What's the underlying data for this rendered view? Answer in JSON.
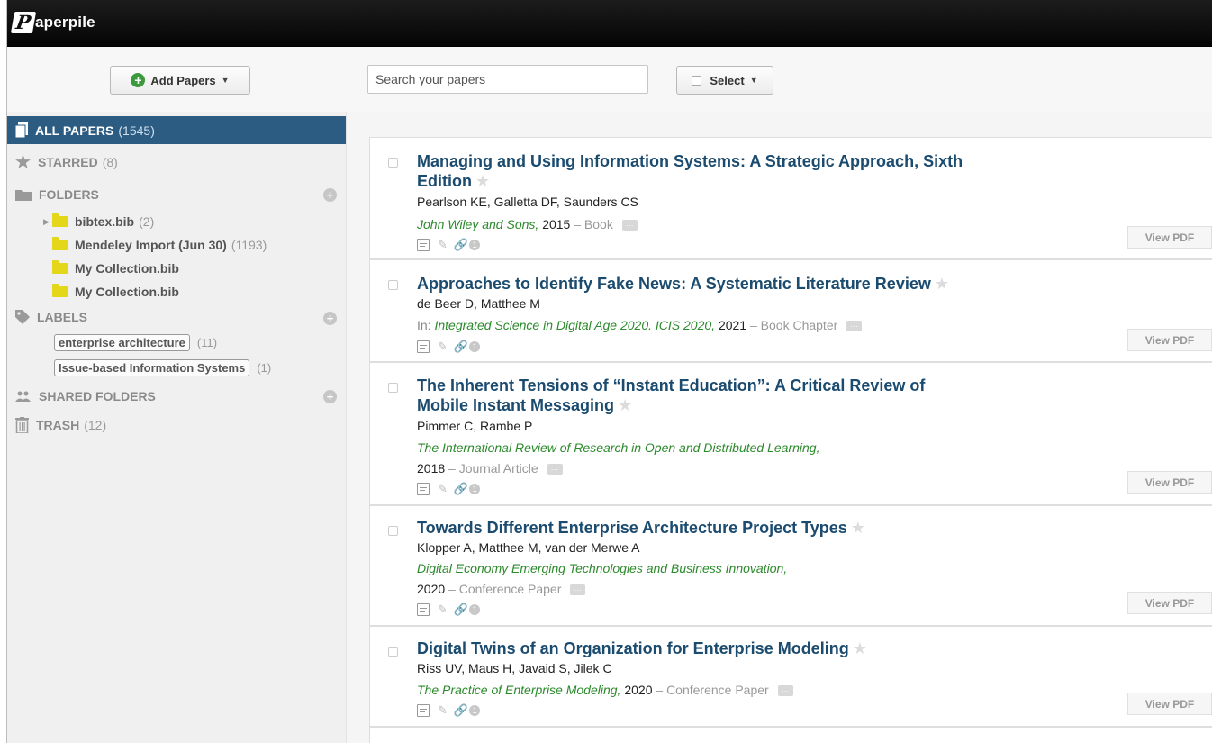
{
  "app": {
    "logo_letter": "P",
    "logo_rest": "aperpile"
  },
  "toolbar": {
    "add_papers_label": "Add Papers",
    "search_placeholder": "Search your papers",
    "select_label": "Select"
  },
  "sidebar": {
    "all_papers": {
      "label": "ALL PAPERS",
      "count": "(1545)"
    },
    "starred": {
      "label": "STARRED",
      "count": "(8)"
    },
    "folders": {
      "label": "FOLDERS",
      "items": [
        {
          "label": "bibtex.bib",
          "count": "(2)"
        },
        {
          "label": "Mendeley Import (Jun 30)",
          "count": "(1193)"
        },
        {
          "label": "My Collection.bib",
          "count": ""
        },
        {
          "label": "My Collection.bib",
          "count": ""
        }
      ]
    },
    "labels": {
      "label": "LABELS",
      "items": [
        {
          "label": "enterprise architecture",
          "count": "(11)"
        },
        {
          "label": "Issue-based Information Systems",
          "count": "(1)"
        }
      ]
    },
    "shared_folders": {
      "label": "SHARED FOLDERS"
    },
    "trash": {
      "label": "TRASH",
      "count": "(12)"
    }
  },
  "papers": [
    {
      "title_l1": "Managing and Using Information Systems: A Strategic Approach, Sixth",
      "title_l2": "Edition",
      "authors": "Pearlson KE, Galletta DF, Saunders CS",
      "venue": "John Wiley and Sons,",
      "year": "2015",
      "type": "– Book",
      "attachments": "1",
      "view_pdf": "View PDF"
    },
    {
      "title_l1": "Approaches to Identify Fake News: A Systematic Literature Review",
      "authors": "de Beer D, Matthee M",
      "venue_prefix": "In:",
      "venue": "Integrated Science in Digital Age 2020. ICIS 2020,",
      "year": "2021",
      "type": "– Book Chapter",
      "attachments": "1",
      "view_pdf": "View PDF"
    },
    {
      "title_l1": "The Inherent Tensions of “Instant Education”: A Critical Review of",
      "title_l2": "Mobile Instant Messaging",
      "authors": "Pimmer C, Rambe P",
      "venue": "The International Review of Research in Open and Distributed Learning,",
      "year": "2018",
      "type": "– Journal Article",
      "attachments": "1",
      "view_pdf": "View PDF"
    },
    {
      "title_l1": "Towards Different Enterprise Architecture Project Types",
      "authors": "Klopper A, Matthee M, van der Merwe A",
      "venue": "Digital Economy Emerging Technologies and Business Innovation,",
      "year": "2020",
      "type": "– Conference Paper",
      "attachments": "1",
      "view_pdf": "View PDF"
    },
    {
      "title_l1": "Digital Twins of an Organization for Enterprise Modeling",
      "authors": "Riss UV, Maus H, Javaid S, Jilek C",
      "venue": "The Practice of Enterprise Modeling,",
      "year": "2020",
      "type": "– Conference Paper",
      "attachments": "1",
      "view_pdf": "View PDF"
    }
  ]
}
